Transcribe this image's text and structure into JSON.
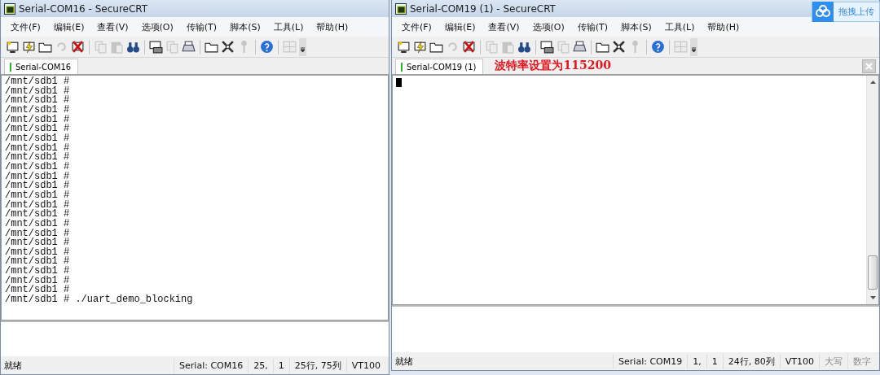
{
  "windows": [
    {
      "title": "Serial-COM16 - SecureCRT",
      "menu": [
        "文件(F)",
        "编辑(E)",
        "查看(V)",
        "选项(O)",
        "传输(T)",
        "脚本(S)",
        "工具(L)",
        "帮助(H)"
      ],
      "toolbar": [
        {
          "kind": "monitor",
          "disabled": false
        },
        {
          "kind": "bolt",
          "disabled": false
        },
        {
          "kind": "folder",
          "disabled": false
        },
        {
          "kind": "reload",
          "disabled": true
        },
        {
          "kind": "cross",
          "disabled": false
        },
        {
          "kind": "sep"
        },
        {
          "kind": "pages",
          "disabled": true
        },
        {
          "kind": "clipboard",
          "disabled": true
        },
        {
          "kind": "binoculars",
          "disabled": false
        },
        {
          "kind": "sep"
        },
        {
          "kind": "screen-printer",
          "disabled": false
        },
        {
          "kind": "pages",
          "disabled": true
        },
        {
          "kind": "printer",
          "disabled": false
        },
        {
          "kind": "sep"
        },
        {
          "kind": "folder",
          "disabled": false
        },
        {
          "kind": "tools",
          "disabled": false
        },
        {
          "kind": "key",
          "disabled": true
        },
        {
          "kind": "sep"
        },
        {
          "kind": "help",
          "disabled": false
        },
        {
          "kind": "sep"
        },
        {
          "kind": "grid",
          "disabled": true
        }
      ],
      "tabs": [
        {
          "label": "Serial-COM16",
          "selected": true
        }
      ],
      "terminal_lines": [
        "/mnt/sdb1 #",
        "/mnt/sdb1 #",
        "/mnt/sdb1 #",
        "/mnt/sdb1 #",
        "/mnt/sdb1 #",
        "/mnt/sdb1 #",
        "/mnt/sdb1 #",
        "/mnt/sdb1 #",
        "/mnt/sdb1 #",
        "/mnt/sdb1 #",
        "/mnt/sdb1 #",
        "/mnt/sdb1 #",
        "/mnt/sdb1 #",
        "/mnt/sdb1 #",
        "/mnt/sdb1 #",
        "/mnt/sdb1 #",
        "/mnt/sdb1 #",
        "/mnt/sdb1 #",
        "/mnt/sdb1 #",
        "/mnt/sdb1 #",
        "/mnt/sdb1 #",
        "/mnt/sdb1 #",
        "/mnt/sdb1 #",
        "/mnt/sdb1 # ./uart_demo_blocking"
      ],
      "status_bar": {
        "message": "就绪",
        "panes": [
          "Serial: COM16",
          "25,",
          "1",
          "25行, 75列",
          "VT100"
        ]
      }
    },
    {
      "title": "Serial-COM19 (1) - SecureCRT",
      "menu": [
        "文件(F)",
        "编辑(E)",
        "查看(V)",
        "选项(O)",
        "传输(T)",
        "脚本(S)",
        "工具(L)",
        "帮助(H)"
      ],
      "toolbar": [
        {
          "kind": "monitor",
          "disabled": false
        },
        {
          "kind": "bolt",
          "disabled": false
        },
        {
          "kind": "folder",
          "disabled": false
        },
        {
          "kind": "reload",
          "disabled": true
        },
        {
          "kind": "cross",
          "disabled": false
        },
        {
          "kind": "sep"
        },
        {
          "kind": "pages",
          "disabled": true
        },
        {
          "kind": "clipboard",
          "disabled": true
        },
        {
          "kind": "binoculars",
          "disabled": false
        },
        {
          "kind": "sep"
        },
        {
          "kind": "screen-printer",
          "disabled": false
        },
        {
          "kind": "pages",
          "disabled": true
        },
        {
          "kind": "printer",
          "disabled": false
        },
        {
          "kind": "sep"
        },
        {
          "kind": "folder",
          "disabled": false
        },
        {
          "kind": "tools",
          "disabled": false
        },
        {
          "kind": "key",
          "disabled": true
        },
        {
          "kind": "sep"
        },
        {
          "kind": "help",
          "disabled": false
        },
        {
          "kind": "sep"
        },
        {
          "kind": "grid",
          "disabled": true
        }
      ],
      "tabs": [
        {
          "label": "Serial-COM19 (1)",
          "selected": true
        }
      ],
      "annotation": "波特率设置为115200",
      "cursor": true,
      "scrollbar": true,
      "status_bar": {
        "message": "就绪",
        "panes": [
          "Serial: COM19",
          "1,",
          "1",
          "24行, 80列",
          "VT100"
        ],
        "indicators": [
          "大写",
          "数字"
        ]
      }
    }
  ],
  "upload_overlay": {
    "label": "拖拽上传"
  }
}
